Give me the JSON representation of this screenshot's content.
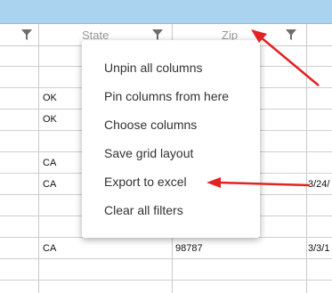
{
  "header": {
    "columns": [
      {
        "label": ""
      },
      {
        "label": "State"
      },
      {
        "label": "Zip"
      },
      {
        "label": ""
      }
    ]
  },
  "rows": [
    {
      "state": "",
      "zip": "",
      "date": ""
    },
    {
      "state": "",
      "zip": "",
      "date": ""
    },
    {
      "state": "OK",
      "zip": "",
      "date": ""
    },
    {
      "state": "OK",
      "zip": "",
      "date": ""
    },
    {
      "state": "",
      "zip": "",
      "date": ""
    },
    {
      "state": "CA",
      "zip": "",
      "date": ""
    },
    {
      "state": "CA",
      "zip": "",
      "date": "3/24/"
    },
    {
      "state": "",
      "zip": "",
      "date": ""
    },
    {
      "state": "",
      "zip": "",
      "date": ""
    },
    {
      "state": "CA",
      "zip": "98787",
      "date": "3/3/1"
    },
    {
      "state": "",
      "zip": "",
      "date": ""
    }
  ],
  "menu": {
    "items": [
      "Unpin all columns",
      "Pin columns from here",
      "Choose columns",
      "Save grid layout",
      "Export to excel",
      "Clear all filters"
    ]
  },
  "colors": {
    "topbar": "#a9d3ee",
    "annotation_arrow": "#e32222"
  }
}
